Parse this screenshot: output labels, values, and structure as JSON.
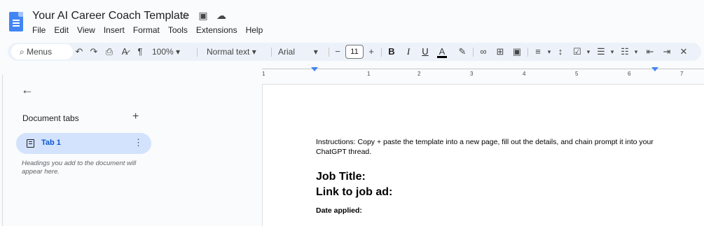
{
  "document": {
    "title": "Your AI Career Coach Template"
  },
  "title_icons": [
    "star-icon",
    "move-to-folder-icon",
    "cloud-saved-icon"
  ],
  "menu": [
    "File",
    "Edit",
    "View",
    "Insert",
    "Format",
    "Tools",
    "Extensions",
    "Help"
  ],
  "toolbar": {
    "search_label": "Menus",
    "zoom": "100%",
    "style": "Normal text",
    "font": "Arial",
    "font_size": "11",
    "minus": "−",
    "plus": "+",
    "bold": "B",
    "italic": "I",
    "underline": "U",
    "text_color": "A"
  },
  "ruler": {
    "ticks": [
      "1",
      "1",
      "2",
      "3",
      "4",
      "5",
      "6",
      "7"
    ]
  },
  "sidebar": {
    "heading": "Document tabs",
    "tab_label": "Tab 1",
    "hint": "Headings you add to the document will appear here."
  },
  "page": {
    "instructions": "Instructions: Copy + paste the template into a new page, fill out the details, and chain prompt it into your ChatGPT thread.",
    "job_title": "Job Title:",
    "link": "Link to job ad:",
    "date_applied": "Date applied:"
  },
  "colors": {
    "accent": "#0b57d0",
    "tab_bg": "#d3e3fd",
    "toolbar_bg": "#edf2fa",
    "doc_icon": "#4285f4"
  }
}
